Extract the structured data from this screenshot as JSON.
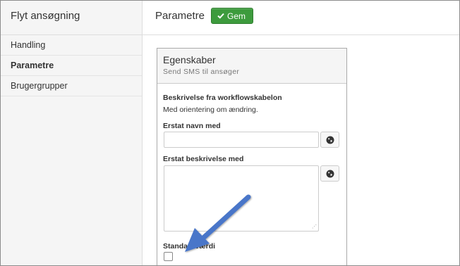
{
  "sidebar": {
    "title": "Flyt ansøgning",
    "items": [
      {
        "label": "Handling",
        "active": false
      },
      {
        "label": "Parametre",
        "active": true
      },
      {
        "label": "Brugergrupper",
        "active": false
      }
    ]
  },
  "header": {
    "title": "Parametre",
    "save_label": "Gem",
    "save_icon": "check-icon",
    "save_color": "#3d9b3d"
  },
  "panel": {
    "title": "Egenskaber",
    "subtitle": "Send SMS til ansøger",
    "description_heading": "Beskrivelse fra workflowskabelon",
    "description_text": "Med orientering om ændring.",
    "replace_name_label": "Erstat navn med",
    "replace_name_value": "",
    "replace_desc_label": "Erstat beskrivelse med",
    "replace_desc_value": "",
    "default_value_label": "Standardværdi",
    "default_value_checked": false,
    "globe_icon": "globe-icon"
  },
  "annotation": {
    "arrow_color": "#4a76c9"
  }
}
